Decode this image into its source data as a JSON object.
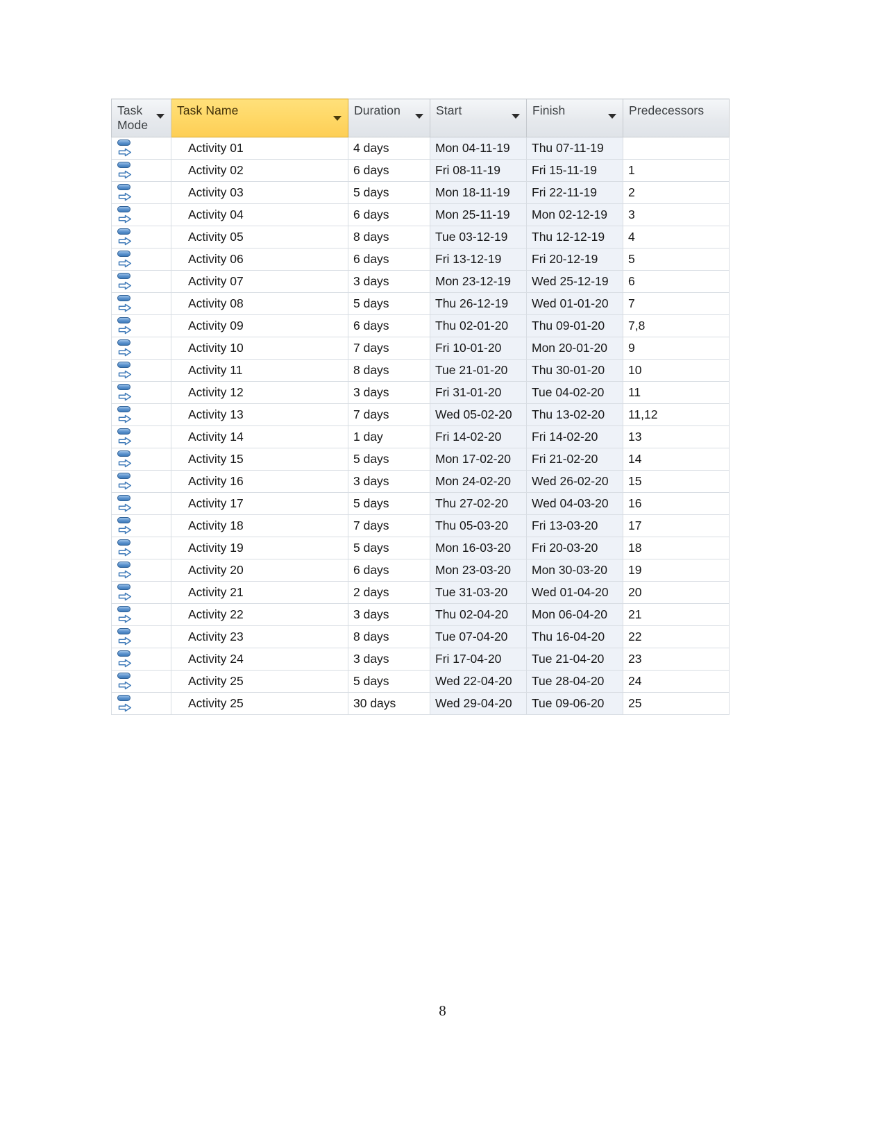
{
  "document": {
    "page_number": "8"
  },
  "grid": {
    "columns": [
      {
        "key": "task_mode",
        "label": "Task Mode",
        "has_filter_arrow": true,
        "highlighted": false,
        "two_line": true
      },
      {
        "key": "task_name",
        "label": "Task Name",
        "has_filter_arrow": true,
        "highlighted": true,
        "two_line": false
      },
      {
        "key": "duration",
        "label": "Duration",
        "has_filter_arrow": true,
        "highlighted": false,
        "two_line": false
      },
      {
        "key": "start",
        "label": "Start",
        "has_filter_arrow": true,
        "highlighted": false,
        "two_line": false
      },
      {
        "key": "finish",
        "label": "Finish",
        "has_filter_arrow": true,
        "highlighted": false,
        "two_line": false
      },
      {
        "key": "predecessors",
        "label": "Predecessors",
        "has_filter_arrow": false,
        "highlighted": false,
        "two_line": false
      }
    ],
    "task_mode_icon": "auto-scheduled-icon",
    "colors": {
      "header_highlight": "#ffd867",
      "header_background": "#e6e9ed",
      "date_cell_background": "#eef2f8",
      "grid_line": "#d8dde3",
      "icon_blue": "#5b92cd"
    },
    "rows": [
      {
        "task_name": "Activity 01",
        "duration": "4 days",
        "start": "Mon 04-11-19",
        "finish": "Thu 07-11-19",
        "predecessors": ""
      },
      {
        "task_name": "Activity 02",
        "duration": "6 days",
        "start": "Fri 08-11-19",
        "finish": "Fri 15-11-19",
        "predecessors": "1"
      },
      {
        "task_name": "Activity 03",
        "duration": "5 days",
        "start": "Mon 18-11-19",
        "finish": "Fri 22-11-19",
        "predecessors": "2"
      },
      {
        "task_name": "Activity 04",
        "duration": "6 days",
        "start": "Mon 25-11-19",
        "finish": "Mon 02-12-19",
        "predecessors": "3"
      },
      {
        "task_name": "Activity 05",
        "duration": "8 days",
        "start": "Tue 03-12-19",
        "finish": "Thu 12-12-19",
        "predecessors": "4"
      },
      {
        "task_name": "Activity 06",
        "duration": "6 days",
        "start": "Fri 13-12-19",
        "finish": "Fri 20-12-19",
        "predecessors": "5"
      },
      {
        "task_name": "Activity 07",
        "duration": "3 days",
        "start": "Mon 23-12-19",
        "finish": "Wed 25-12-19",
        "predecessors": "6"
      },
      {
        "task_name": "Activity 08",
        "duration": "5 days",
        "start": "Thu 26-12-19",
        "finish": "Wed 01-01-20",
        "predecessors": "7"
      },
      {
        "task_name": "Activity 09",
        "duration": "6 days",
        "start": "Thu 02-01-20",
        "finish": "Thu 09-01-20",
        "predecessors": "7,8"
      },
      {
        "task_name": "Activity 10",
        "duration": "7 days",
        "start": "Fri 10-01-20",
        "finish": "Mon 20-01-20",
        "predecessors": "9"
      },
      {
        "task_name": "Activity 11",
        "duration": "8 days",
        "start": "Tue 21-01-20",
        "finish": "Thu 30-01-20",
        "predecessors": "10"
      },
      {
        "task_name": "Activity 12",
        "duration": "3 days",
        "start": "Fri 31-01-20",
        "finish": "Tue 04-02-20",
        "predecessors": "11"
      },
      {
        "task_name": "Activity 13",
        "duration": "7 days",
        "start": "Wed 05-02-20",
        "finish": "Thu 13-02-20",
        "predecessors": "11,12"
      },
      {
        "task_name": "Activity 14",
        "duration": "1 day",
        "start": "Fri 14-02-20",
        "finish": "Fri 14-02-20",
        "predecessors": "13"
      },
      {
        "task_name": "Activity 15",
        "duration": "5 days",
        "start": "Mon 17-02-20",
        "finish": "Fri 21-02-20",
        "predecessors": "14"
      },
      {
        "task_name": "Activity 16",
        "duration": "3 days",
        "start": "Mon 24-02-20",
        "finish": "Wed 26-02-20",
        "predecessors": "15"
      },
      {
        "task_name": "Activity 17",
        "duration": "5 days",
        "start": "Thu 27-02-20",
        "finish": "Wed 04-03-20",
        "predecessors": "16"
      },
      {
        "task_name": "Activity 18",
        "duration": "7 days",
        "start": "Thu 05-03-20",
        "finish": "Fri 13-03-20",
        "predecessors": "17"
      },
      {
        "task_name": "Activity 19",
        "duration": "5 days",
        "start": "Mon 16-03-20",
        "finish": "Fri 20-03-20",
        "predecessors": "18"
      },
      {
        "task_name": "Activity 20",
        "duration": "6 days",
        "start": "Mon 23-03-20",
        "finish": "Mon 30-03-20",
        "predecessors": "19"
      },
      {
        "task_name": "Activity 21",
        "duration": "2 days",
        "start": "Tue 31-03-20",
        "finish": "Wed 01-04-20",
        "predecessors": "20"
      },
      {
        "task_name": "Activity 22",
        "duration": "3 days",
        "start": "Thu 02-04-20",
        "finish": "Mon 06-04-20",
        "predecessors": "21"
      },
      {
        "task_name": "Activity 23",
        "duration": "8 days",
        "start": "Tue 07-04-20",
        "finish": "Thu 16-04-20",
        "predecessors": "22"
      },
      {
        "task_name": "Activity 24",
        "duration": "3 days",
        "start": "Fri 17-04-20",
        "finish": "Tue 21-04-20",
        "predecessors": "23"
      },
      {
        "task_name": "Activity 25",
        "duration": "5 days",
        "start": "Wed 22-04-20",
        "finish": "Tue 28-04-20",
        "predecessors": "24"
      },
      {
        "task_name": "Activity 25",
        "duration": "30 days",
        "start": "Wed 29-04-20",
        "finish": "Tue 09-06-20",
        "predecessors": "25"
      }
    ]
  }
}
